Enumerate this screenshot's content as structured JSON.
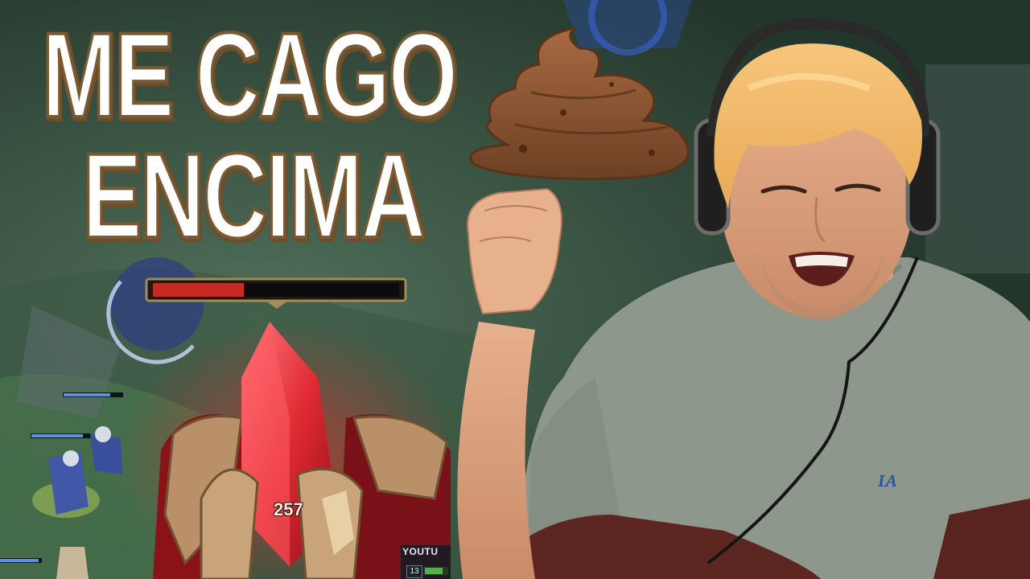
{
  "thumbnail": {
    "title_line1": "ME CAGO",
    "title_line2": "ENCIMA",
    "damage_number": "257",
    "hud_tag": "YOUTU",
    "hud_level": "13",
    "shirt_logo": "LA",
    "health_fraction": 0.37
  },
  "colors": {
    "title_fill": "#ffffff",
    "title_outline": "#7a5a33",
    "health_red": "#c62a22",
    "crystal_red": "#e02a32",
    "shirt_gray": "#8e978c",
    "hair_blond": "#f0be6e"
  },
  "icons": [
    "poop-emoji-icon"
  ]
}
